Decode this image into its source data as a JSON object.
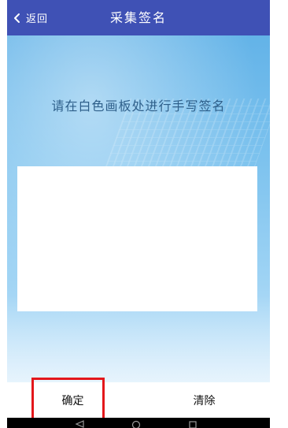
{
  "header": {
    "back_label": "返回",
    "title": "采集签名"
  },
  "content": {
    "instruction": "请在白色画板处进行手写签名"
  },
  "actions": {
    "confirm_label": "确定",
    "clear_label": "清除"
  },
  "colors": {
    "header_bg": "#3f51b5",
    "highlight_outline": "#e3171b"
  },
  "icons": {
    "back": "chevron-left-icon",
    "nav_back": "triangle-back-icon",
    "nav_home": "circle-home-icon",
    "nav_recents": "square-recents-icon"
  }
}
